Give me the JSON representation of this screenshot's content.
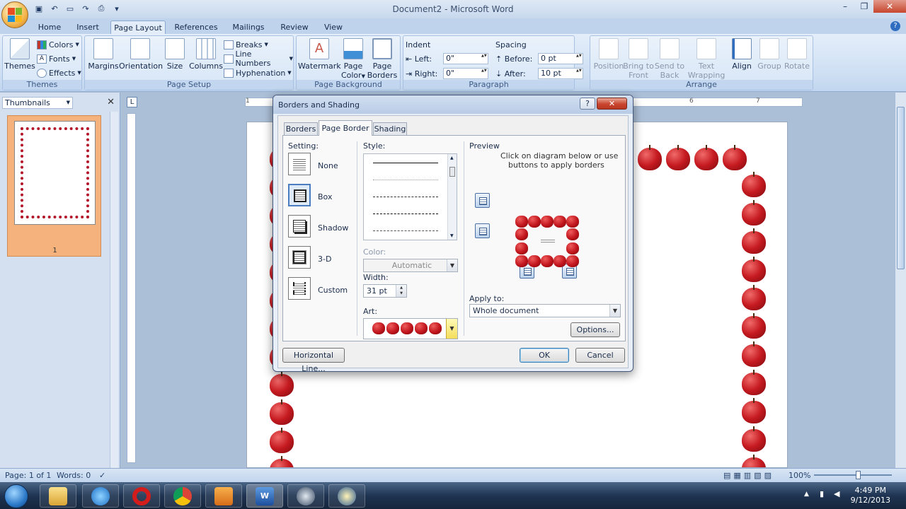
{
  "window": {
    "title": "Document2 - Microsoft Word",
    "controls": [
      "–",
      "❐",
      "✕"
    ]
  },
  "quick_access": [
    "save-icon",
    "undo-icon",
    "open-icon",
    "redo-icon",
    "print-icon",
    "customize-icon"
  ],
  "ribbon": {
    "tabs": [
      "Home",
      "Insert",
      "Page Layout",
      "References",
      "Mailings",
      "Review",
      "View"
    ],
    "active_tab": "Page Layout",
    "themes": {
      "label": "Themes",
      "themes_btn": "Themes",
      "colors": "Colors",
      "fonts": "Fonts",
      "effects": "Effects"
    },
    "page_setup": {
      "label": "Page Setup",
      "margins": "Margins",
      "orientation": "Orientation",
      "size": "Size",
      "columns": "Columns",
      "breaks": "Breaks",
      "line_numbers": "Line Numbers",
      "hyphenation": "Hyphenation"
    },
    "page_background": {
      "label": "Page Background",
      "watermark": "Watermark",
      "page_color_1": "Page",
      "page_color_2": "Color",
      "page_borders_1": "Page",
      "page_borders_2": "Borders"
    },
    "paragraph": {
      "label": "Paragraph",
      "indent_label": "Indent",
      "left_label": "Left:",
      "left_value": "0\"",
      "right_label": "Right:",
      "right_value": "0\"",
      "spacing_label": "Spacing",
      "before_label": "Before:",
      "before_value": "0 pt",
      "after_label": "After:",
      "after_value": "10 pt"
    },
    "arrange": {
      "label": "Arrange",
      "position": "Position",
      "bring_front_1": "Bring to",
      "bring_front_2": "Front",
      "send_back_1": "Send to",
      "send_back_2": "Back",
      "text_wrap_1": "Text",
      "text_wrap_2": "Wrapping",
      "align": "Align",
      "group": "Group",
      "rotate": "Rotate"
    }
  },
  "thumbnails": {
    "title": "Thumbnails",
    "page_number": "1"
  },
  "ruler_numbers": [
    "1",
    "6",
    "7"
  ],
  "status_bar": {
    "page": "Page: 1 of 1",
    "words": "Words: 0",
    "zoom": "100%"
  },
  "taskbar": {
    "time": "4:49 PM",
    "date": "9/12/2013",
    "apps": [
      "explorer",
      "internet-explorer",
      "opera",
      "chrome",
      "media-player",
      "word",
      "app-7",
      "app-8"
    ]
  },
  "dialog": {
    "title": "Borders and Shading",
    "help": "?",
    "close": "✕",
    "tabs": [
      "Borders",
      "Page Border",
      "Shading"
    ],
    "active_tab": "Page Border",
    "setting_label": "Setting:",
    "settings": [
      "None",
      "Box",
      "Shadow",
      "3-D",
      "Custom"
    ],
    "selected_setting": "Box",
    "style_label": "Style:",
    "color_label": "Color:",
    "color_value": "Automatic",
    "width_label": "Width:",
    "width_value": "31 pt",
    "art_label": "Art:",
    "preview_label": "Preview",
    "preview_hint_1": "Click on diagram below or use",
    "preview_hint_2": "buttons to apply borders",
    "apply_to_label": "Apply to:",
    "apply_to_value": "Whole document",
    "options_btn": "Options...",
    "horizontal_line_btn": "Horizontal Line...",
    "ok_btn": "OK",
    "cancel_btn": "Cancel"
  },
  "colors": {
    "apple_red": "#c51a20",
    "accent": "#2f6dc0",
    "thumb_highlight": "#f6b27c"
  }
}
